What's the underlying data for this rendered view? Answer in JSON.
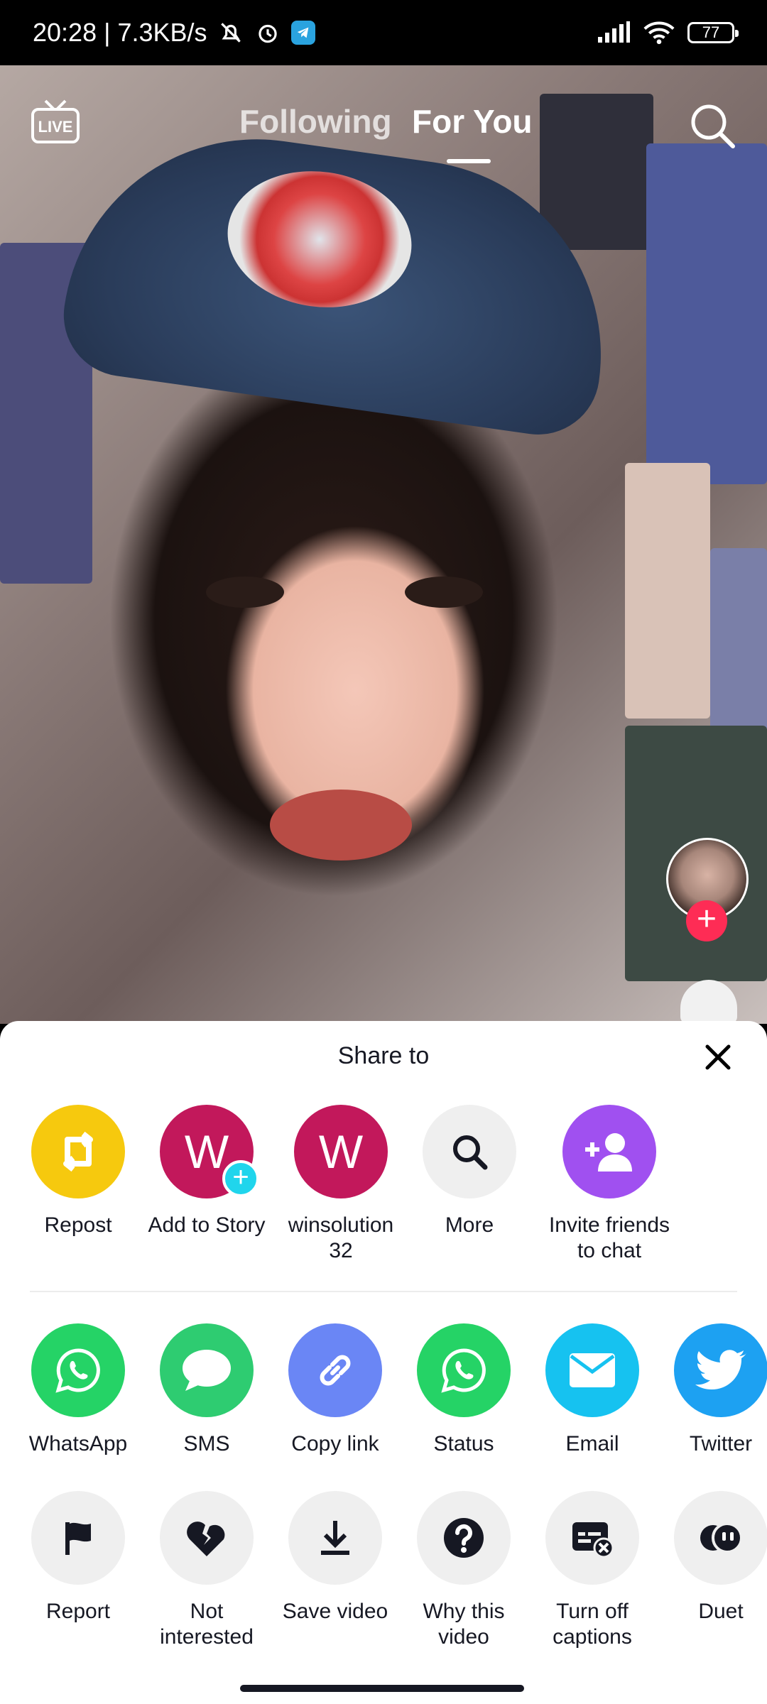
{
  "status_bar": {
    "time_speed": "20:28 | 7.3KB/s",
    "battery": "77"
  },
  "top_nav": {
    "live_label": "LIVE",
    "tab_following": "Following",
    "tab_for_you": "For You"
  },
  "share_sheet": {
    "title": "Share to",
    "contacts_row": [
      {
        "label": "Repost",
        "color": "#f6c90e",
        "icon": "repost-icon"
      },
      {
        "label": "Add to Story",
        "color": "#c2185b",
        "avatar_letter": "W"
      },
      {
        "label": "winsolution 32",
        "color": "#c2185b",
        "avatar_letter": "W"
      },
      {
        "label": "More",
        "color": "#efefef",
        "icon": "search-icon"
      },
      {
        "label": "Invite friends to chat",
        "color": "#a050f0",
        "icon": "add-user-icon"
      }
    ],
    "apps_row": [
      {
        "label": "WhatsApp",
        "color": "#25d366",
        "icon": "whatsapp-icon"
      },
      {
        "label": "SMS",
        "color": "#2ecc71",
        "icon": "sms-icon"
      },
      {
        "label": "Copy link",
        "color": "#6a86f5",
        "icon": "link-icon"
      },
      {
        "label": "Status",
        "color": "#25d366",
        "icon": "whatsapp-status-icon"
      },
      {
        "label": "Email",
        "color": "#16c2f0",
        "icon": "email-icon"
      },
      {
        "label": "Twitter",
        "color": "#1da1f2",
        "icon": "twitter-icon"
      }
    ],
    "actions_row": [
      {
        "label": "Report",
        "icon": "flag-icon"
      },
      {
        "label": "Not interested",
        "icon": "broken-heart-icon"
      },
      {
        "label": "Save video",
        "icon": "download-icon"
      },
      {
        "label": "Why this video",
        "icon": "question-icon"
      },
      {
        "label": "Turn off captions",
        "icon": "captions-off-icon"
      },
      {
        "label": "Duet",
        "icon": "duet-icon"
      }
    ]
  }
}
